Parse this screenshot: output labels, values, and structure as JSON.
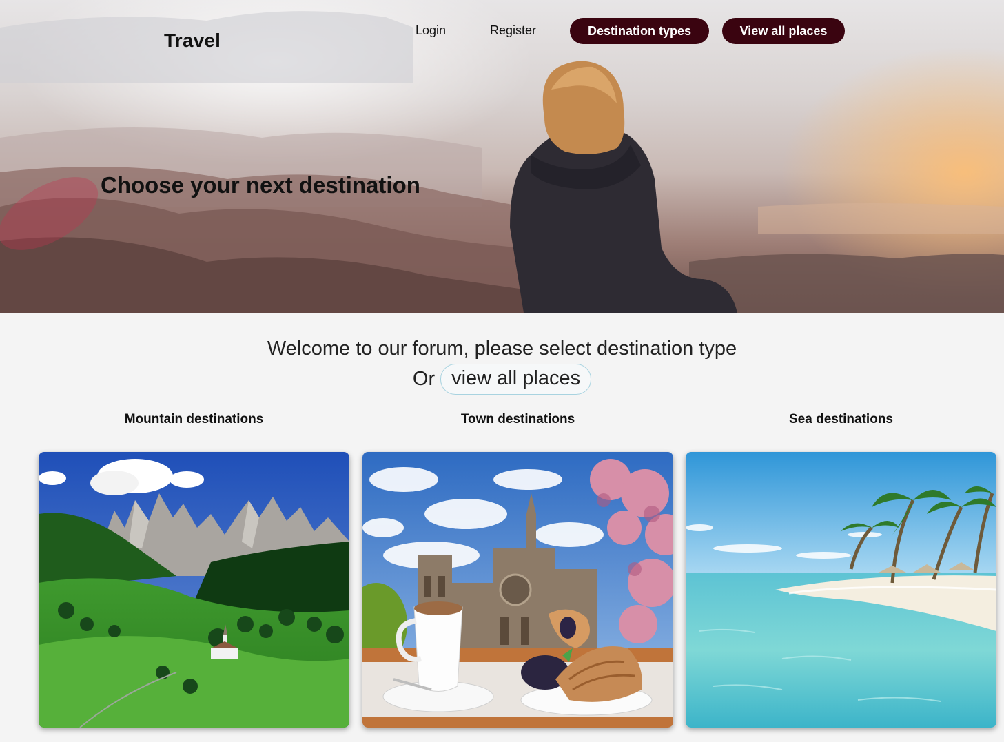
{
  "header": {
    "brand": "Travel",
    "nav": {
      "login": "Login",
      "register": "Register",
      "destination_types": "Destination types",
      "view_all_places": "View all places"
    },
    "pill_color": "#3a0410"
  },
  "hero": {
    "heading": "Choose your next destination"
  },
  "welcome": {
    "line1": "Welcome to our forum, please select destination type",
    "or_text": "Or",
    "view_all_link": "view all places"
  },
  "categories": [
    {
      "title": "Mountain destinations"
    },
    {
      "title": "Town destinations"
    },
    {
      "title": "Sea destinations"
    }
  ],
  "colors": {
    "page_background": "#f4f4f4",
    "link_border": "#a8d3e0"
  }
}
